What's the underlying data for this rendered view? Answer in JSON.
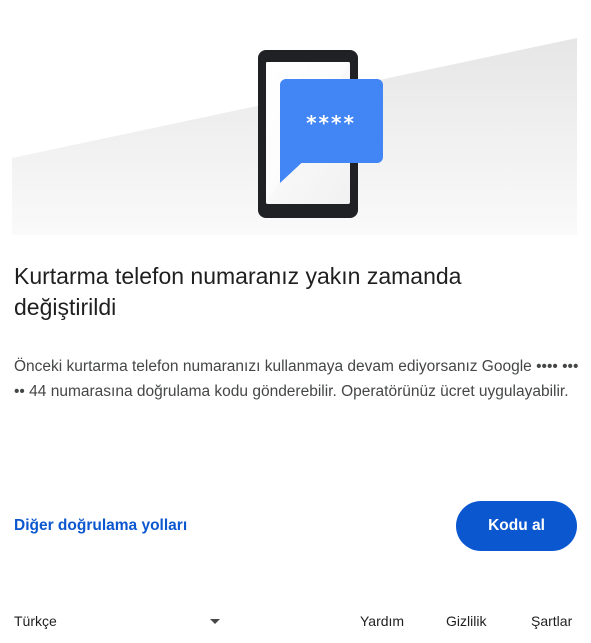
{
  "illustration": {
    "masked_code": "****",
    "colors": {
      "bubble": "#4285f4",
      "phone_frame": "#202124",
      "floor": "#ebebeb"
    }
  },
  "heading": {
    "title": "Kurtarma telefon numaranız yakın zamanda değiştirildi"
  },
  "body": {
    "description": "Önceki kurtarma telefon numaranızı kullanmaya devam ediyorsanız Google •••• ••• •• 44 numarasına doğrulama kodu gönderebilir. Operatörünüz ücret uygulayabilir."
  },
  "actions": {
    "other_methods_label": "Diğer doğrulama yolları",
    "get_code_label": "Kodu al",
    "accent_color": "#0b57d0"
  },
  "footer": {
    "language": "Türkçe",
    "help": "Yardım",
    "privacy": "Gizlilik",
    "terms": "Şartlar"
  }
}
